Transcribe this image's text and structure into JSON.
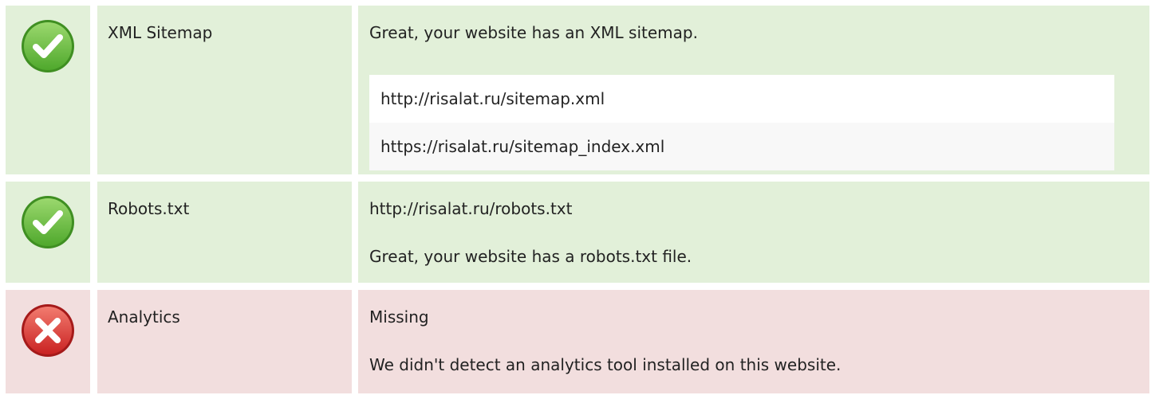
{
  "checks": [
    {
      "status": "pass",
      "icon": "check-circle-icon",
      "label": "XML Sitemap",
      "message": "Great, your website has an XML sitemap.",
      "urls": [
        "http://risalat.ru/sitemap.xml",
        "https://risalat.ru/sitemap_index.xml"
      ]
    },
    {
      "status": "pass",
      "icon": "check-circle-icon",
      "label": "Robots.txt",
      "value": "http://risalat.ru/robots.txt",
      "message": "Great, your website has a robots.txt file."
    },
    {
      "status": "fail",
      "icon": "x-circle-icon",
      "label": "Analytics",
      "value": "Missing",
      "message": "We didn't detect an analytics tool installed on this website."
    }
  ],
  "colors": {
    "pass_bg": "#e2f0d9",
    "fail_bg": "#f2dede",
    "pass_icon": "#6cc04a",
    "fail_icon": "#e03c3c"
  }
}
